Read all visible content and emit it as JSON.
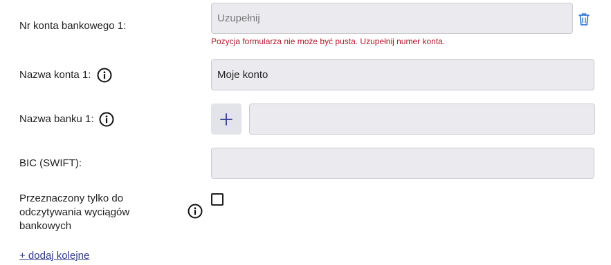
{
  "account_number": {
    "label": "Nr konta bankowego 1:",
    "placeholder": "Uzupełnij",
    "value": "",
    "error": "Pozycja formularza nie może być pusta. Uzupełnij numer konta.",
    "delete_icon": "trash-icon"
  },
  "account_name": {
    "label": "Nazwa konta 1:",
    "value": "Moje konto",
    "info_icon": "info-icon"
  },
  "bank_name": {
    "label": "Nazwa banku 1:",
    "value": "",
    "info_icon": "info-icon",
    "add_icon": "plus-icon"
  },
  "bic": {
    "label": "BIC (SWIFT):",
    "value": ""
  },
  "read_only": {
    "label_lines": [
      "Przeznaczony tylko do",
      "odczytywania wyciągów",
      "bankowych"
    ],
    "checked": false,
    "info_icon": "info-icon"
  },
  "add_more": {
    "label": "+ dodaj kolejne"
  },
  "colors": {
    "field_bg": "#ebebef",
    "error": "#b0182a",
    "accent": "#2e3a8c",
    "trash": "#3a7bd5"
  }
}
